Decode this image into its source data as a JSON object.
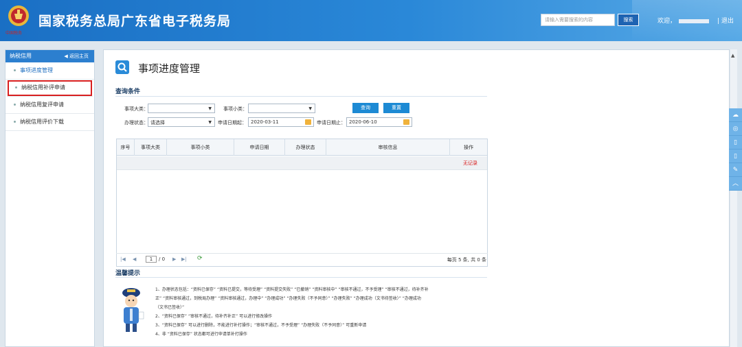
{
  "header": {
    "logo_text": "中国税务",
    "title": "国家税务总局广东省电子税务局",
    "search_placeholder": "请输入需要搜索的内容",
    "search_button": "搜索",
    "welcome": "欢迎，",
    "logout": "| 退出"
  },
  "sidebar": {
    "title": "纳税信用",
    "back_label": "◀ 返回主页",
    "items": [
      {
        "label": "事项进度管理"
      },
      {
        "label": "纳税信用补评申请"
      },
      {
        "label": "纳税信用复评申请"
      },
      {
        "label": "纳税信用评价下载"
      }
    ]
  },
  "main": {
    "title": "事项进度管理",
    "query_section": "查询条件",
    "fields": {
      "major_label": "事项大类：",
      "minor_label": "事项小类：",
      "status_label": "办理状态：",
      "status_value": "请选择",
      "date_from_label": "申请日期起：",
      "date_from_value": "2020-03-11",
      "date_to_label": "申请日期止：",
      "date_to_value": "2020-06-10"
    },
    "buttons": {
      "query": "查询",
      "reset": "重置"
    },
    "table": {
      "columns": [
        "序号",
        "事项大类",
        "事项小类",
        "申请日期",
        "办理状态",
        "审核信息",
        "操作"
      ],
      "no_record": "无记录"
    },
    "pager": {
      "first": "|◀",
      "prev": "◀",
      "page": "1",
      "total_pages": "/ 0",
      "next": "▶",
      "last": "▶|",
      "refresh": "⟳",
      "info": "每页 5 条, 共 0 条"
    },
    "tips_title": "温馨提示",
    "tips": [
      "1、办理状态包括：“资料已保存” “资料已提交，等待受理” “资料提交失败” “已撤销” “资料审核中” “审核不通过，不予受理” “审核不通过，待补齐补",
      "正” “资料审核通过，到税局办理” “资料审核通过，办理中” “办理成功” “办理失败（不予同意）” “办理失败” “办理成功（文书待签收）” “办理成功",
      "（文书已签收）”",
      "2、“资料已保存” “审核不通过，待补齐补正” 可以进行修改操作",
      "3、“资料已保存” 可以进行删除，不能进行补打操作；“审核不通过，不予受理” “办理失败（不予同意）” 可重新申请",
      "4、非 “资料已保存” 状态都可进行申请单补打操作"
    ]
  },
  "colors": {
    "header_blue": "#1a6fc4",
    "accent_blue": "#1d8ad4",
    "highlight_red": "#d81e1e"
  }
}
